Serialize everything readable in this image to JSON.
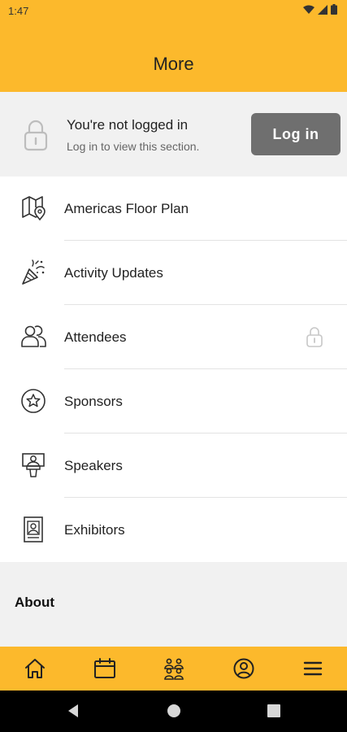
{
  "status_bar": {
    "time": "1:47"
  },
  "header": {
    "title": "More"
  },
  "login_banner": {
    "title": "You're not logged in",
    "subtitle": "Log in to view this section.",
    "button_label": "Log in"
  },
  "menu": {
    "items": [
      {
        "label": "Americas Floor Plan",
        "icon": "map-pin-icon",
        "locked": false
      },
      {
        "label": "Activity Updates",
        "icon": "party-popper-icon",
        "locked": false
      },
      {
        "label": "Attendees",
        "icon": "people-icon",
        "locked": true
      },
      {
        "label": "Sponsors",
        "icon": "star-badge-icon",
        "locked": false
      },
      {
        "label": "Speakers",
        "icon": "speaker-podium-icon",
        "locked": false
      },
      {
        "label": "Exhibitors",
        "icon": "exhibitor-booth-icon",
        "locked": false
      }
    ]
  },
  "about": {
    "title": "About"
  },
  "tabbar": {
    "tabs": [
      {
        "icon": "home-icon"
      },
      {
        "icon": "calendar-icon"
      },
      {
        "icon": "attendees-group-icon"
      },
      {
        "icon": "profile-icon"
      },
      {
        "icon": "menu-icon"
      }
    ]
  },
  "colors": {
    "accent": "#fcb92c",
    "button": "#6f6f6f",
    "background": "#f1f1f1"
  }
}
